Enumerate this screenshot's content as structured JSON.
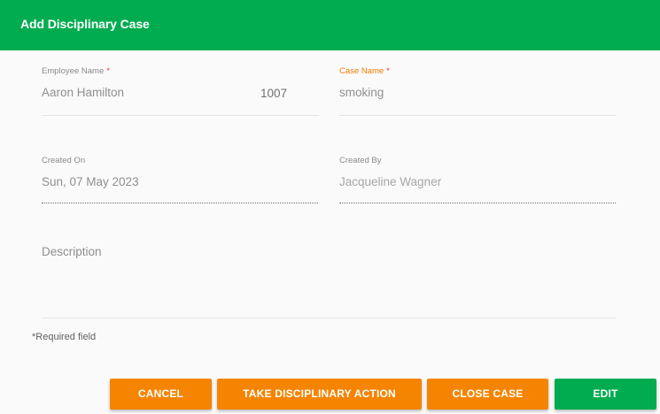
{
  "dialog": {
    "title": "Add Disciplinary Case"
  },
  "form": {
    "employee_name": {
      "label": "Employee Name",
      "required_marker": "*",
      "value": "Aaron Hamilton",
      "employee_id": "1007"
    },
    "case_name": {
      "label": "Case Name",
      "required_marker": "*",
      "value": "smoking"
    },
    "created_on": {
      "label": "Created On",
      "value": "Sun, 07 May 2023"
    },
    "created_by": {
      "label": "Created By",
      "value": "Jacqueline Wagner"
    },
    "description": {
      "placeholder": "Description",
      "value": ""
    },
    "required_note": "*Required field"
  },
  "actions": {
    "cancel_label": "CANCEL",
    "take_action_label": "TAKE DISCIPLINARY ACTION",
    "close_case_label": "CLOSE CASE",
    "edit_label": "EDIT"
  },
  "colors": {
    "header_green": "#00ac4f",
    "button_orange": "#f58400",
    "button_green": "#00ac4f",
    "focused_label_orange": "#f27c00",
    "required_red": "#e53935"
  }
}
